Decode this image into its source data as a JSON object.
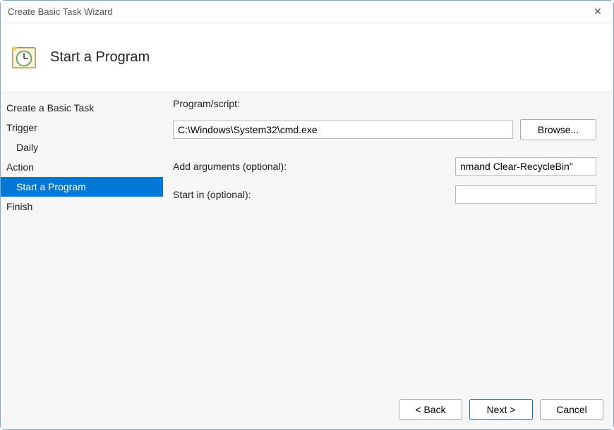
{
  "window": {
    "title": "Create Basic Task Wizard"
  },
  "header": {
    "title": "Start a Program"
  },
  "sidebar": {
    "items": [
      {
        "label": "Create a Basic Task",
        "sub": false,
        "selected": false
      },
      {
        "label": "Trigger",
        "sub": false,
        "selected": false
      },
      {
        "label": "Daily",
        "sub": true,
        "selected": false
      },
      {
        "label": "Action",
        "sub": false,
        "selected": false
      },
      {
        "label": "Start a Program",
        "sub": true,
        "selected": true
      },
      {
        "label": "Finish",
        "sub": false,
        "selected": false
      }
    ]
  },
  "form": {
    "program_label": "Program/script:",
    "program_value": "C:\\Windows\\System32\\cmd.exe",
    "browse_label": "Browse...",
    "args_label": "Add arguments (optional):",
    "args_value": "nmand Clear-RecycleBin\"",
    "startin_label": "Start in (optional):",
    "startin_value": ""
  },
  "footer": {
    "back": "< Back",
    "next": "Next >",
    "cancel": "Cancel"
  }
}
